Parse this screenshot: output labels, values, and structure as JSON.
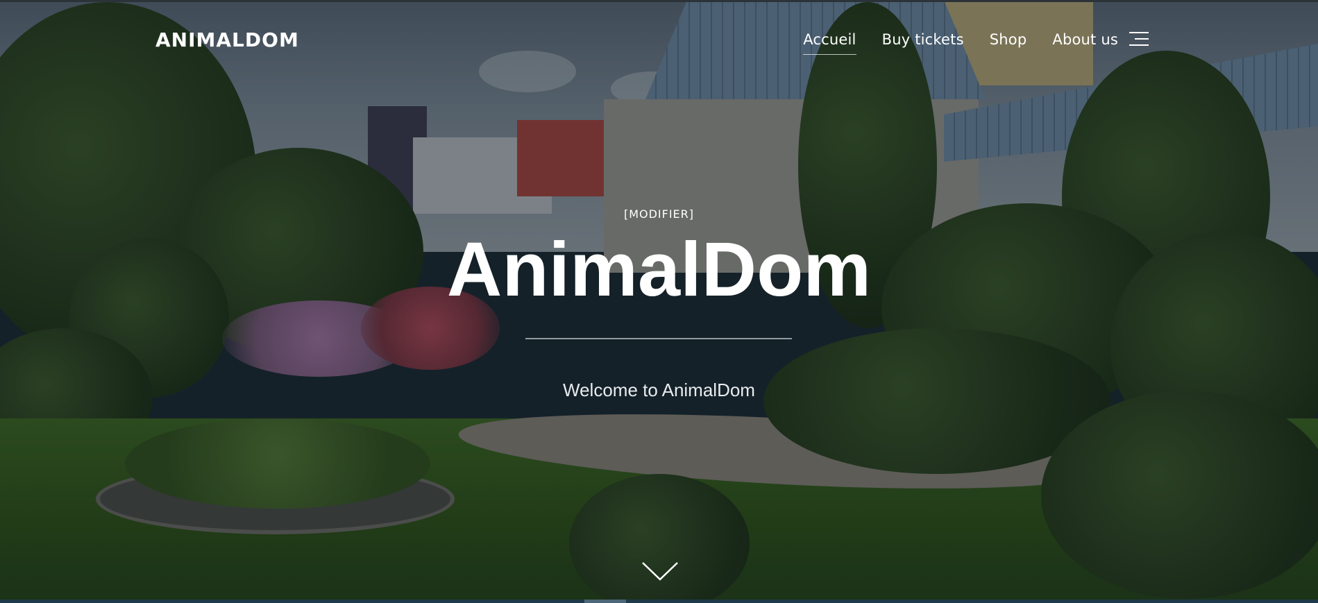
{
  "nav": {
    "logo": "ANIMALDOM",
    "items": [
      {
        "label": "Accueil",
        "active": true
      },
      {
        "label": "Buy tickets",
        "active": false
      },
      {
        "label": "Shop",
        "active": false
      },
      {
        "label": "About us",
        "active": false
      }
    ],
    "menu_icon": "hamburger-menu-icon"
  },
  "hero": {
    "kicker": "[MODIFIER]",
    "title": "AnimalDom",
    "subtitle": "Welcome to AnimalDom",
    "scroll_icon": "chevron-down-icon"
  },
  "colors": {
    "text": "#ffffff",
    "overlay": "#0a1016",
    "bottom_bar": "#1f3a4a"
  }
}
